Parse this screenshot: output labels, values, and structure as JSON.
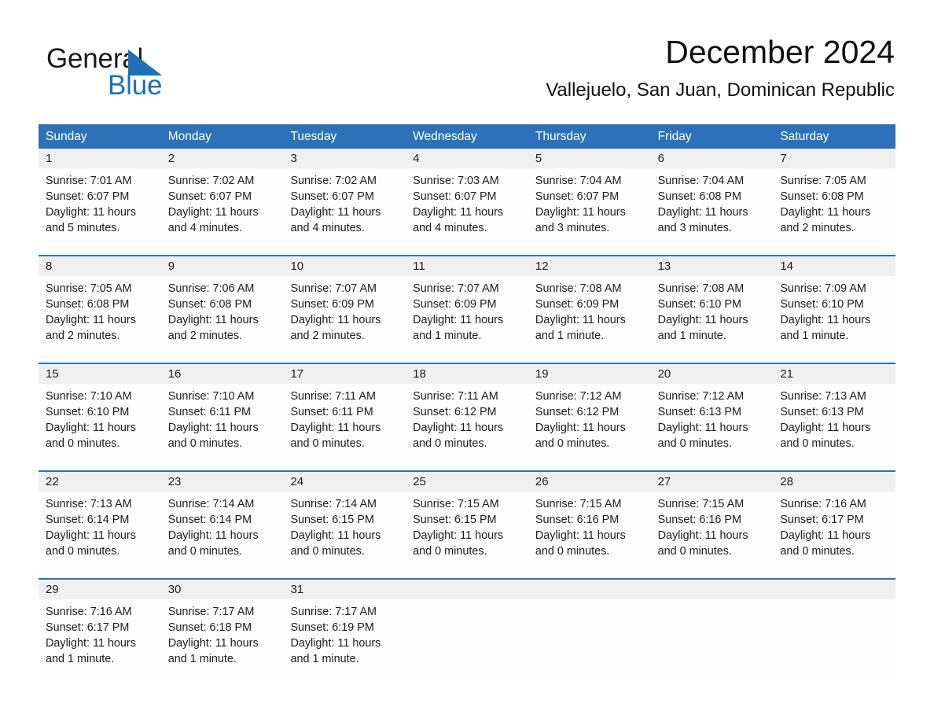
{
  "brand": {
    "word1": "General",
    "word2": "Blue",
    "triangle_color": "#1d71b8",
    "text_color": "#1a1a1a"
  },
  "header": {
    "title": "December 2024",
    "subtitle": "Vallejuelo, San Juan, Dominican Republic"
  },
  "colors": {
    "header_blue": "#2d72b8",
    "row_band_gray": "#f0f0f0",
    "cell_white": "#fdfdfd"
  },
  "weekdays": [
    "Sunday",
    "Monday",
    "Tuesday",
    "Wednesday",
    "Thursday",
    "Friday",
    "Saturday"
  ],
  "weeks": [
    {
      "days": [
        {
          "num": "1",
          "sunrise": "Sunrise: 7:01 AM",
          "sunset": "Sunset: 6:07 PM",
          "daylight1": "Daylight: 11 hours",
          "daylight2": "and 5 minutes."
        },
        {
          "num": "2",
          "sunrise": "Sunrise: 7:02 AM",
          "sunset": "Sunset: 6:07 PM",
          "daylight1": "Daylight: 11 hours",
          "daylight2": "and 4 minutes."
        },
        {
          "num": "3",
          "sunrise": "Sunrise: 7:02 AM",
          "sunset": "Sunset: 6:07 PM",
          "daylight1": "Daylight: 11 hours",
          "daylight2": "and 4 minutes."
        },
        {
          "num": "4",
          "sunrise": "Sunrise: 7:03 AM",
          "sunset": "Sunset: 6:07 PM",
          "daylight1": "Daylight: 11 hours",
          "daylight2": "and 4 minutes."
        },
        {
          "num": "5",
          "sunrise": "Sunrise: 7:04 AM",
          "sunset": "Sunset: 6:07 PM",
          "daylight1": "Daylight: 11 hours",
          "daylight2": "and 3 minutes."
        },
        {
          "num": "6",
          "sunrise": "Sunrise: 7:04 AM",
          "sunset": "Sunset: 6:08 PM",
          "daylight1": "Daylight: 11 hours",
          "daylight2": "and 3 minutes."
        },
        {
          "num": "7",
          "sunrise": "Sunrise: 7:05 AM",
          "sunset": "Sunset: 6:08 PM",
          "daylight1": "Daylight: 11 hours",
          "daylight2": "and 2 minutes."
        }
      ]
    },
    {
      "days": [
        {
          "num": "8",
          "sunrise": "Sunrise: 7:05 AM",
          "sunset": "Sunset: 6:08 PM",
          "daylight1": "Daylight: 11 hours",
          "daylight2": "and 2 minutes."
        },
        {
          "num": "9",
          "sunrise": "Sunrise: 7:06 AM",
          "sunset": "Sunset: 6:08 PM",
          "daylight1": "Daylight: 11 hours",
          "daylight2": "and 2 minutes."
        },
        {
          "num": "10",
          "sunrise": "Sunrise: 7:07 AM",
          "sunset": "Sunset: 6:09 PM",
          "daylight1": "Daylight: 11 hours",
          "daylight2": "and 2 minutes."
        },
        {
          "num": "11",
          "sunrise": "Sunrise: 7:07 AM",
          "sunset": "Sunset: 6:09 PM",
          "daylight1": "Daylight: 11 hours",
          "daylight2": "and 1 minute."
        },
        {
          "num": "12",
          "sunrise": "Sunrise: 7:08 AM",
          "sunset": "Sunset: 6:09 PM",
          "daylight1": "Daylight: 11 hours",
          "daylight2": "and 1 minute."
        },
        {
          "num": "13",
          "sunrise": "Sunrise: 7:08 AM",
          "sunset": "Sunset: 6:10 PM",
          "daylight1": "Daylight: 11 hours",
          "daylight2": "and 1 minute."
        },
        {
          "num": "14",
          "sunrise": "Sunrise: 7:09 AM",
          "sunset": "Sunset: 6:10 PM",
          "daylight1": "Daylight: 11 hours",
          "daylight2": "and 1 minute."
        }
      ]
    },
    {
      "days": [
        {
          "num": "15",
          "sunrise": "Sunrise: 7:10 AM",
          "sunset": "Sunset: 6:10 PM",
          "daylight1": "Daylight: 11 hours",
          "daylight2": "and 0 minutes."
        },
        {
          "num": "16",
          "sunrise": "Sunrise: 7:10 AM",
          "sunset": "Sunset: 6:11 PM",
          "daylight1": "Daylight: 11 hours",
          "daylight2": "and 0 minutes."
        },
        {
          "num": "17",
          "sunrise": "Sunrise: 7:11 AM",
          "sunset": "Sunset: 6:11 PM",
          "daylight1": "Daylight: 11 hours",
          "daylight2": "and 0 minutes."
        },
        {
          "num": "18",
          "sunrise": "Sunrise: 7:11 AM",
          "sunset": "Sunset: 6:12 PM",
          "daylight1": "Daylight: 11 hours",
          "daylight2": "and 0 minutes."
        },
        {
          "num": "19",
          "sunrise": "Sunrise: 7:12 AM",
          "sunset": "Sunset: 6:12 PM",
          "daylight1": "Daylight: 11 hours",
          "daylight2": "and 0 minutes."
        },
        {
          "num": "20",
          "sunrise": "Sunrise: 7:12 AM",
          "sunset": "Sunset: 6:13 PM",
          "daylight1": "Daylight: 11 hours",
          "daylight2": "and 0 minutes."
        },
        {
          "num": "21",
          "sunrise": "Sunrise: 7:13 AM",
          "sunset": "Sunset: 6:13 PM",
          "daylight1": "Daylight: 11 hours",
          "daylight2": "and 0 minutes."
        }
      ]
    },
    {
      "days": [
        {
          "num": "22",
          "sunrise": "Sunrise: 7:13 AM",
          "sunset": "Sunset: 6:14 PM",
          "daylight1": "Daylight: 11 hours",
          "daylight2": "and 0 minutes."
        },
        {
          "num": "23",
          "sunrise": "Sunrise: 7:14 AM",
          "sunset": "Sunset: 6:14 PM",
          "daylight1": "Daylight: 11 hours",
          "daylight2": "and 0 minutes."
        },
        {
          "num": "24",
          "sunrise": "Sunrise: 7:14 AM",
          "sunset": "Sunset: 6:15 PM",
          "daylight1": "Daylight: 11 hours",
          "daylight2": "and 0 minutes."
        },
        {
          "num": "25",
          "sunrise": "Sunrise: 7:15 AM",
          "sunset": "Sunset: 6:15 PM",
          "daylight1": "Daylight: 11 hours",
          "daylight2": "and 0 minutes."
        },
        {
          "num": "26",
          "sunrise": "Sunrise: 7:15 AM",
          "sunset": "Sunset: 6:16 PM",
          "daylight1": "Daylight: 11 hours",
          "daylight2": "and 0 minutes."
        },
        {
          "num": "27",
          "sunrise": "Sunrise: 7:15 AM",
          "sunset": "Sunset: 6:16 PM",
          "daylight1": "Daylight: 11 hours",
          "daylight2": "and 0 minutes."
        },
        {
          "num": "28",
          "sunrise": "Sunrise: 7:16 AM",
          "sunset": "Sunset: 6:17 PM",
          "daylight1": "Daylight: 11 hours",
          "daylight2": "and 0 minutes."
        }
      ]
    },
    {
      "days": [
        {
          "num": "29",
          "sunrise": "Sunrise: 7:16 AM",
          "sunset": "Sunset: 6:17 PM",
          "daylight1": "Daylight: 11 hours",
          "daylight2": "and 1 minute."
        },
        {
          "num": "30",
          "sunrise": "Sunrise: 7:17 AM",
          "sunset": "Sunset: 6:18 PM",
          "daylight1": "Daylight: 11 hours",
          "daylight2": "and 1 minute."
        },
        {
          "num": "31",
          "sunrise": "Sunrise: 7:17 AM",
          "sunset": "Sunset: 6:19 PM",
          "daylight1": "Daylight: 11 hours",
          "daylight2": "and 1 minute."
        },
        {
          "num": "",
          "sunrise": "",
          "sunset": "",
          "daylight1": "",
          "daylight2": ""
        },
        {
          "num": "",
          "sunrise": "",
          "sunset": "",
          "daylight1": "",
          "daylight2": ""
        },
        {
          "num": "",
          "sunrise": "",
          "sunset": "",
          "daylight1": "",
          "daylight2": ""
        },
        {
          "num": "",
          "sunrise": "",
          "sunset": "",
          "daylight1": "",
          "daylight2": ""
        }
      ]
    }
  ]
}
